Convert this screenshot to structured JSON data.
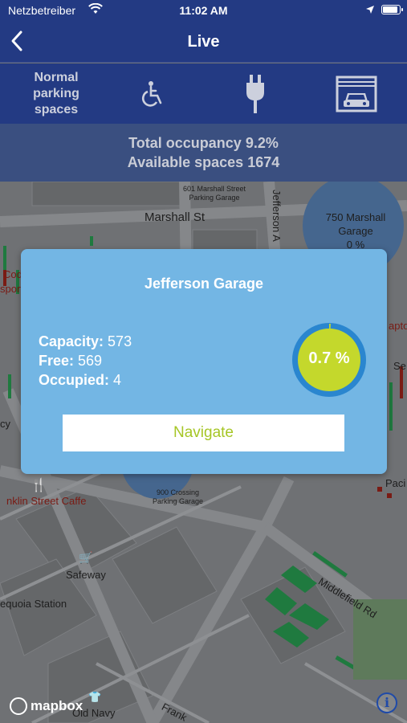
{
  "status_bar": {
    "carrier": "Netzbetreiber",
    "time": "11:02 AM"
  },
  "navbar": {
    "title": "Live",
    "back_icon": "chevron-left-icon"
  },
  "filters": {
    "normal_label": "Normal parking spaces",
    "items": [
      {
        "name": "wheelchair-icon"
      },
      {
        "name": "ev-plug-icon"
      },
      {
        "name": "garage-icon"
      }
    ]
  },
  "occupancy": {
    "total_text": "Total occupancy 9.2%",
    "available_text": "Available spaces 1674"
  },
  "map": {
    "labels": {
      "marshall_st": "Marshall St",
      "jefferson_ave": "Jefferson A",
      "garage_601_line1": "601 Marshall Street",
      "garage_601_line2": "Parking Garage",
      "garage_750_line1": "750 Marshall",
      "garage_750_line2": "Garage",
      "garage_750_pct": "0 %",
      "garage_900_line1": "900 Crossing",
      "garage_900_line2": "Parking Garage",
      "franklin_caffe": "nklin Street Caffe",
      "safeway": "Safeway",
      "sequoia_station": "equoia Station",
      "middlefield_rd": "Middlefield Rd",
      "old_navy": "Old Navy",
      "frank": "Frank",
      "cod": "Cod",
      "sport": "sport",
      "sea": "Se",
      "pacific": "Paci",
      "capto": "apto",
      "cy": "cy",
      "mapbox": "mapbox"
    }
  },
  "popup": {
    "title": "Jefferson Garage",
    "capacity_label": "Capacity:",
    "capacity_value": "573",
    "free_label": "Free:",
    "free_value": "569",
    "occupied_label": "Occupied:",
    "occupied_value": "4",
    "occupancy_percent_text": "0.7 %",
    "occupancy_fraction": 0.007,
    "navigate_label": "Navigate",
    "colors": {
      "gauge_fill": "#c4d82c",
      "gauge_ring": "#2a86cf",
      "button_text": "#a6c626"
    }
  }
}
